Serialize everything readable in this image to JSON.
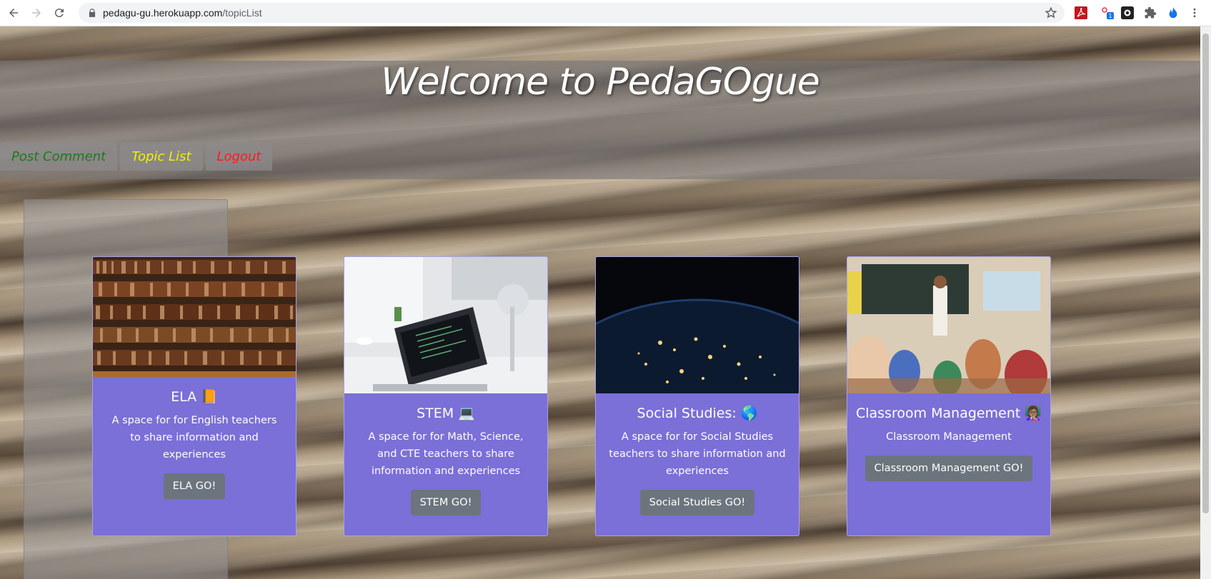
{
  "browser": {
    "url_host": "pedagu-gu.herokuapp.com",
    "url_path": "/topicList"
  },
  "header": {
    "title": "Welcome to PedaGOgue"
  },
  "nav": {
    "tabs": [
      {
        "label": "Post Comment",
        "color": "#1d7a1d"
      },
      {
        "label": "Topic List",
        "color": "#f2f200"
      },
      {
        "label": "Logout",
        "color": "#ff1a1a"
      }
    ]
  },
  "cards": [
    {
      "title": "ELA 📙",
      "text": "A space for for English teachers to share information and experiences",
      "button": "ELA GO!",
      "image": "bookshelf-image"
    },
    {
      "title": "STEM 💻",
      "text": "A space for for Math, Science, and CTE teachers to share information and experiences",
      "button": "STEM GO!",
      "image": "laptop-image"
    },
    {
      "title": "Social Studies: 🌎",
      "text": "A space for for Social Studies teachers to share information and experiences",
      "button": "Social Studies GO!",
      "image": "earth-night-image"
    },
    {
      "title": "Classroom Management 👩🏽‍🏫",
      "text": "Classroom Management",
      "button": "Classroom Management GO!",
      "image": "classroom-image"
    }
  ],
  "colors": {
    "card_bg": "#7b6fd8",
    "button_bg": "#6c757d"
  }
}
